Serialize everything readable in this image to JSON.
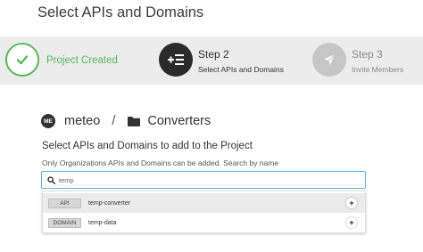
{
  "page": {
    "title": "Select APIs and Domains"
  },
  "stepper": {
    "step1": {
      "label": "Project Created"
    },
    "step2": {
      "number_label": "Step 2",
      "sublabel": "Select APIs and Domains"
    },
    "step3": {
      "number_label": "Step 3",
      "sublabel": "Invite Members"
    }
  },
  "breadcrumb": {
    "avatar_initials": "ME",
    "org": "meteo",
    "separator": "/",
    "project": "Converters"
  },
  "content": {
    "instruction": "Select APIs and Domains to add to the Project",
    "hint": "Only Organizations APIs and Domains can be added. Search by name"
  },
  "search": {
    "value": "temp"
  },
  "results": [
    {
      "type": "API",
      "name": "temp-converter",
      "action": "+"
    },
    {
      "type": "DOMAIN",
      "name": "temp-data",
      "action": "+"
    }
  ],
  "colors": {
    "success": "#58b75a",
    "active": "#2b2b2b",
    "inactive": "#c6c6c6",
    "focus": "#66aee0"
  },
  "icons": {
    "step1": "check-icon",
    "step2": "add-list-icon",
    "step3": "send-icon",
    "folder": "folder-icon",
    "search": "search-icon",
    "add": "plus-icon"
  }
}
